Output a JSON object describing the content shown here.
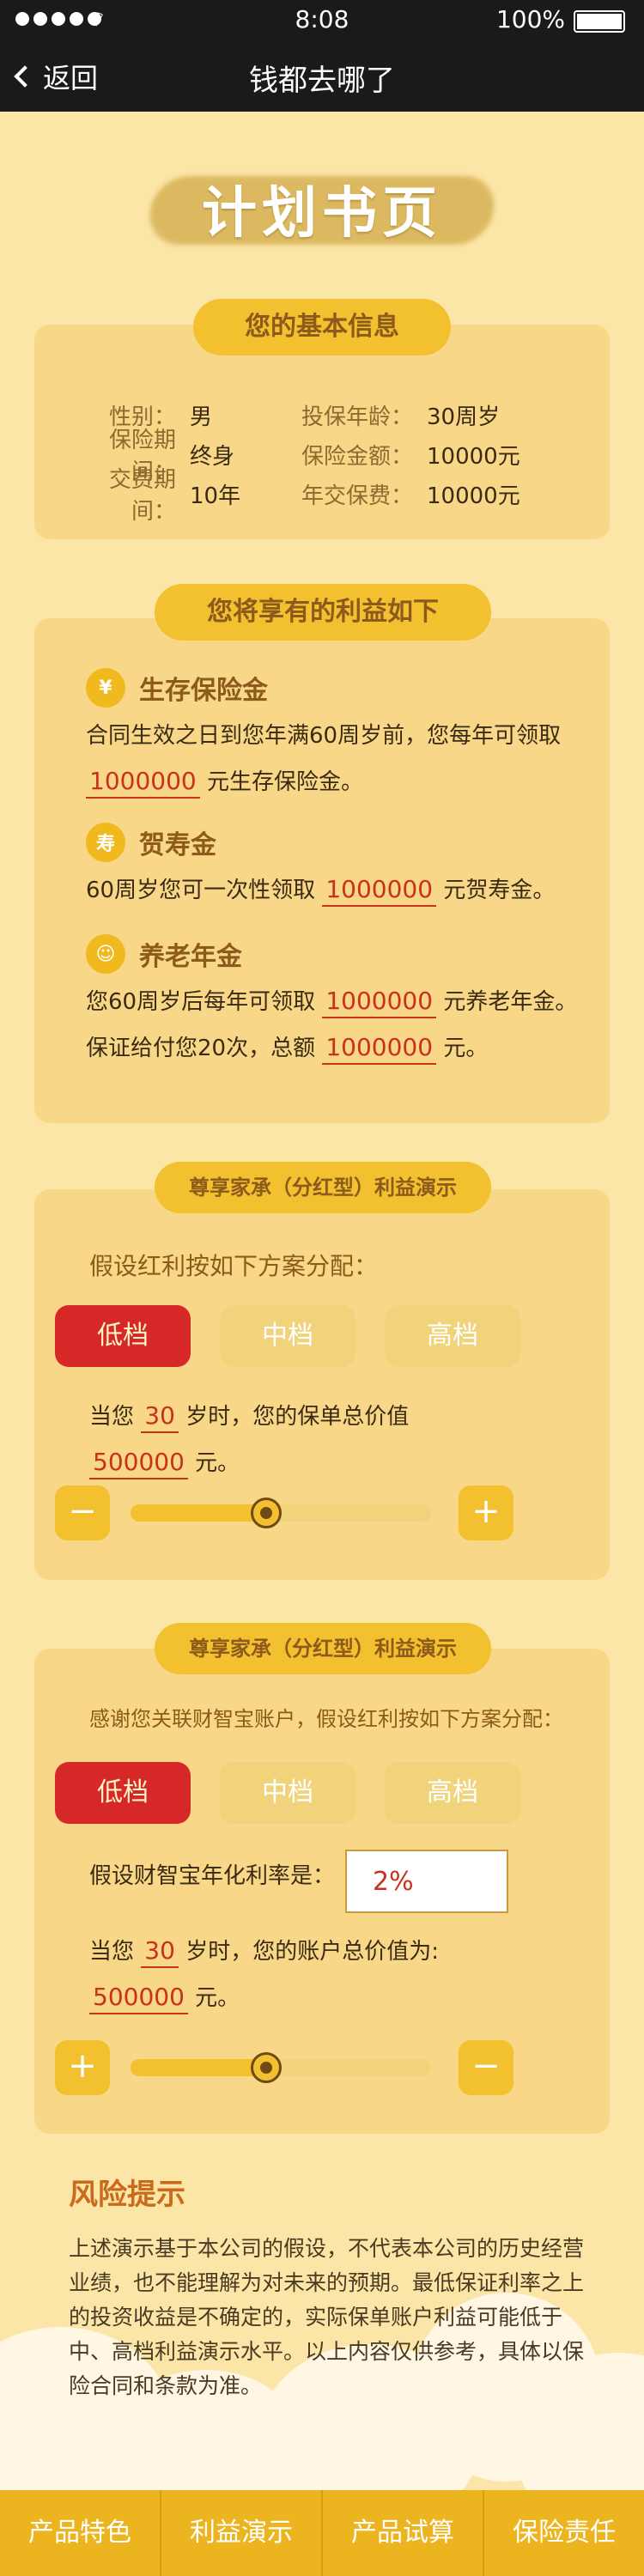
{
  "status_bar": {
    "time": "8:08",
    "battery": "100%"
  },
  "nav": {
    "back_label": "返回",
    "title": "钱都去哪了"
  },
  "hero": {
    "title": "计划书页"
  },
  "basic_info": {
    "heading": "您的基本信息",
    "rows": [
      {
        "l1": "性别：",
        "v1": "男",
        "l2": "投保年龄：",
        "v2": "30周岁"
      },
      {
        "l1": "保险期间：",
        "v1": "终身",
        "l2": "保险金额：",
        "v2": "10000元"
      },
      {
        "l1": "交费期间：",
        "v1": "10年",
        "l2": "年交保费：",
        "v2": "10000元"
      }
    ]
  },
  "benefits": {
    "heading": "您将享有的利益如下",
    "survival": {
      "icon": "¥",
      "title": "生存保险金",
      "text1": "合同生效之日到您年满60周岁前，您每年可领取",
      "amount": "1000000",
      "text2": "元生存保险金。"
    },
    "longevity": {
      "icon": "寿",
      "title": "贺寿金",
      "text1": "60周岁您可一次性领取",
      "amount": "1000000",
      "text2": "元贺寿金。"
    },
    "pension": {
      "icon": "☺",
      "title": "养老年金",
      "text1": "您60周岁后每年可领取",
      "amount": "1000000",
      "text2": "元养老年金。",
      "text3": "保证给付您20次，总额",
      "amount2": "1000000",
      "text4": "元。"
    }
  },
  "demo1": {
    "heading": "尊享家承（分红型）利益演示",
    "prompt": "假设红利按如下方案分配：",
    "tabs": [
      "低档",
      "中档",
      "高档"
    ],
    "line1_a": "当您",
    "age": "30",
    "line1_b": "岁时，您的保单总价值",
    "value": "500000",
    "unit": "元。",
    "minus": "−",
    "plus": "+",
    "slider_fraction": 0.45
  },
  "demo2": {
    "heading": "尊享家承（分红型）利益演示",
    "prompt": "感谢您关联财智宝账户，假设红利按如下方案分配：",
    "tabs": [
      "低档",
      "中档",
      "高档"
    ],
    "rate_label": "假设财智宝年化利率是：",
    "rate_value": "2%",
    "line1_a": "当您",
    "age": "30",
    "line1_b": "岁时，您的账户总价值为:",
    "value": "500000",
    "unit": "元。",
    "plus": "+",
    "minus": "−",
    "slider_fraction": 0.45
  },
  "risk": {
    "title": "风险提示",
    "text": "上述演示基于本公司的假设，不代表本公司的历史经营业绩，也不能理解为对未来的预期。最低保证利率之上的投资收益是不确定的，实际保单账户利益可能低于中、高档利益演示水平。以上内容仅供参考，具体以保险合同和条款为准。"
  },
  "bottom_tabs": [
    "产品特色",
    "利益演示",
    "产品试算",
    "保险责任"
  ]
}
